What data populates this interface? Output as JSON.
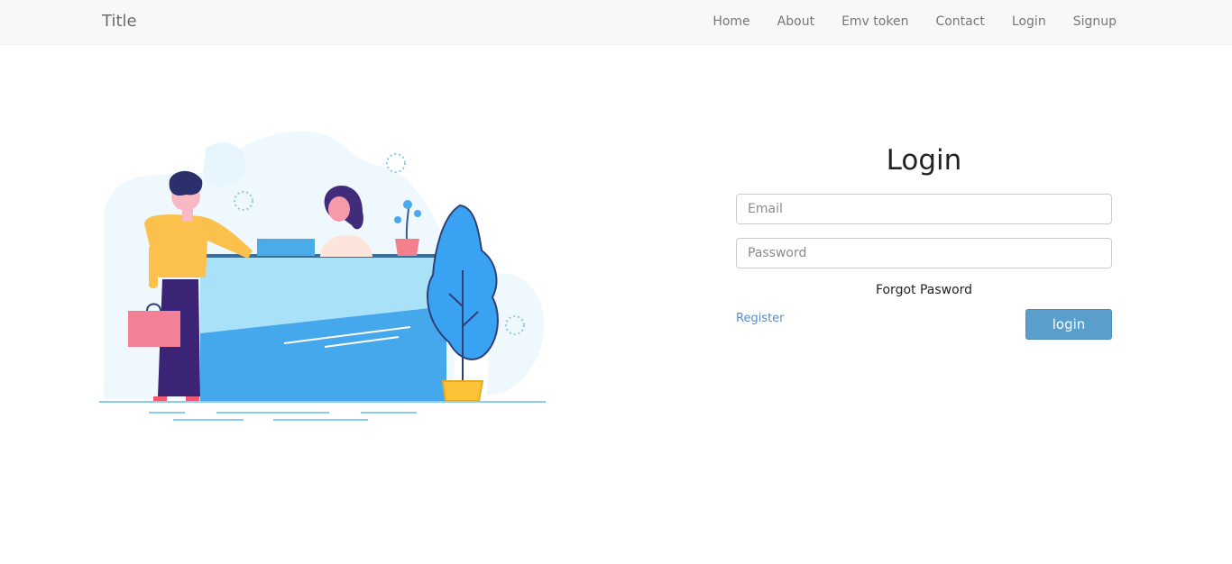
{
  "navbar": {
    "brand": "Title",
    "links": [
      "Home",
      "About",
      "Emv token",
      "Contact",
      "Login",
      "Signup"
    ]
  },
  "login": {
    "title": "Login",
    "email_placeholder": "Email",
    "password_placeholder": "Password",
    "forgot_label": "Forgot Pasword",
    "register_label": "Register",
    "submit_label": "login"
  },
  "colors": {
    "button": "#5a9fcb",
    "link": "#5b8cc9",
    "navbar_bg": "#f8f8f8"
  },
  "icons": [
    "reception-illustration"
  ]
}
